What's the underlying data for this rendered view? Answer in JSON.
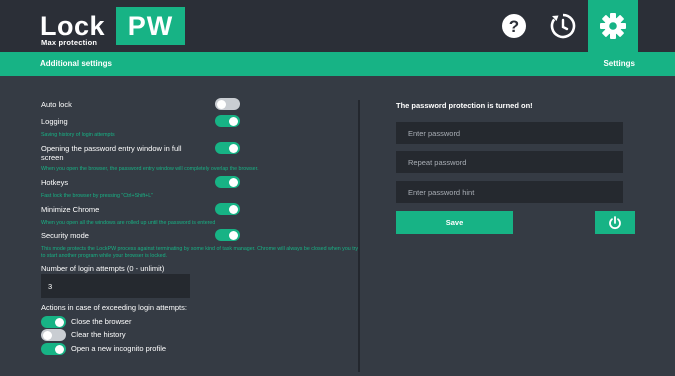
{
  "colors": {
    "accent": "#17b385",
    "topbar": "#2b2f37",
    "background": "#353b44",
    "field": "#25292f"
  },
  "logo": {
    "lock": "Lock",
    "pw": "PW",
    "subtitle": "Max protection"
  },
  "header_icons": [
    "help-icon",
    "history-icon",
    "gear-icon"
  ],
  "subbar": {
    "left": "Additional settings",
    "right": "Settings"
  },
  "settings": {
    "auto_lock": {
      "label": "Auto lock",
      "enabled": false
    },
    "logging": {
      "label": "Logging",
      "hint": "Saving history of login attempts",
      "enabled": true
    },
    "fullscreen": {
      "label": "Opening the password entry window in full screen",
      "hint": "When you open the browser, the password entry window will completely overlap the browser.",
      "enabled": true
    },
    "hotkeys": {
      "label": "Hotkeys",
      "hint": "Fast lock the browser by pressing \"Ctrl+Shift+L\"",
      "enabled": true
    },
    "minimize": {
      "label": "Minimize Chrome",
      "hint": "When you open all the windows are rolled up until the password is entered",
      "enabled": true
    },
    "security": {
      "label": "Security mode",
      "hint": "This mode protects the LockPW process against terminating by some kind of task manager. Chrome will always be closed when you try to start another program while your browser is locked.",
      "enabled": true
    }
  },
  "attempts": {
    "label": "Number of login attempts (0 - unlimit)",
    "value": "3"
  },
  "actions": {
    "title": "Actions in case of exceeding login attempts:",
    "close_browser": {
      "label": "Close the browser",
      "enabled": true
    },
    "clear_history": {
      "label": "Clear the history",
      "enabled": false
    },
    "incognito": {
      "label": "Open a new incognito profile",
      "enabled": true
    }
  },
  "password": {
    "status": "The password protection is turned on!",
    "password_placeholder": "Enter password",
    "repeat_placeholder": "Repeat password",
    "hint_placeholder": "Enter password hint",
    "save_label": "Save"
  }
}
